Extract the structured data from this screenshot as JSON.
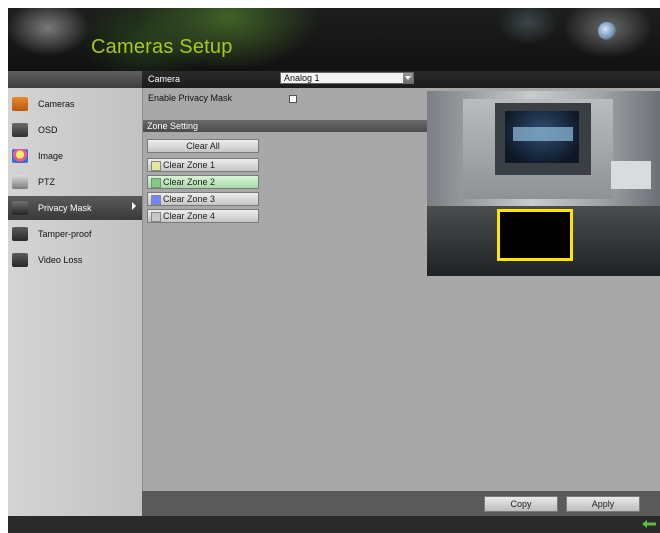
{
  "header": {
    "title": "Cameras Setup"
  },
  "sidebar": {
    "items": [
      {
        "label": "Cameras",
        "icon": "camera-setup-icon"
      },
      {
        "label": "OSD",
        "icon": "osd-icon"
      },
      {
        "label": "Image",
        "icon": "image-icon"
      },
      {
        "label": "PTZ",
        "icon": "ptz-icon"
      },
      {
        "label": "Privacy Mask",
        "icon": "privacy-mask-icon",
        "active": true
      },
      {
        "label": "Tamper-proof",
        "icon": "tamper-proof-icon"
      },
      {
        "label": "Video Loss",
        "icon": "video-loss-icon"
      }
    ]
  },
  "main": {
    "camera_label": "Camera",
    "camera_value": "Analog 1",
    "enable_label": "Enable Privacy Mask",
    "enable_checked": false,
    "zone_section_title": "Zone Setting",
    "clear_all_label": "Clear All",
    "zones": [
      {
        "label": "Clear Zone 1",
        "color": "#e6e6a0"
      },
      {
        "label": "Clear Zone 2",
        "color": "#7ed07e"
      },
      {
        "label": "Clear Zone 3",
        "color": "#6f86ff"
      },
      {
        "label": "Clear Zone 4",
        "color": "#c8c8c8"
      }
    ],
    "mask_color": "#ffe400"
  },
  "actions": {
    "copy_label": "Copy",
    "apply_label": "Apply"
  },
  "colors": {
    "accent_title": "#a8c820",
    "active_item": "#444444",
    "content_bg": "#a8a8a8"
  }
}
